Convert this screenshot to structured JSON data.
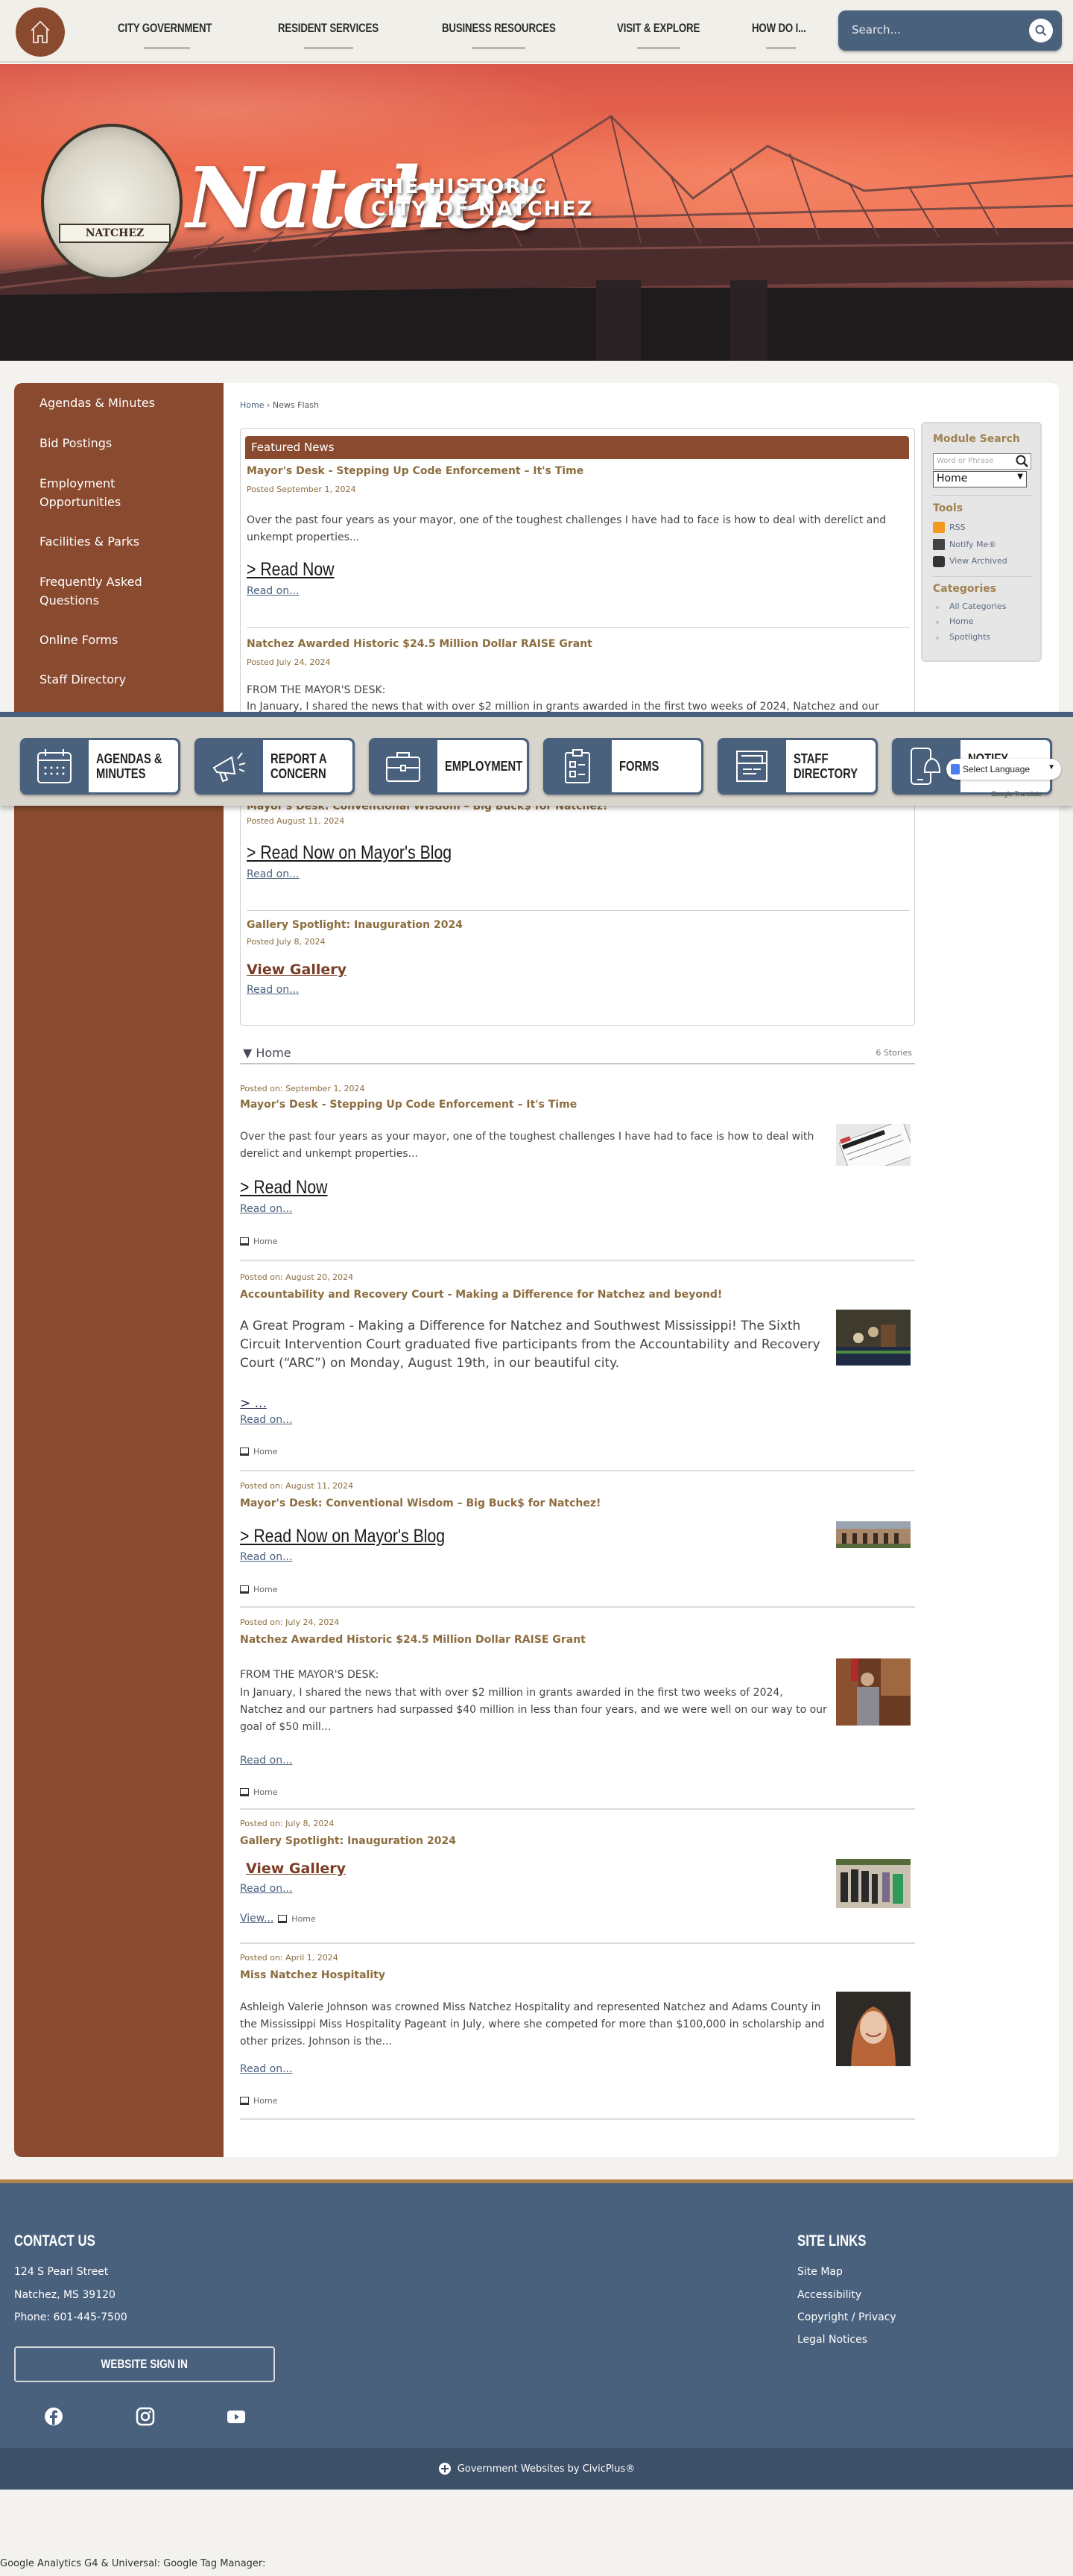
{
  "nav": {
    "items": [
      "CITY GOVERNMENT",
      "RESIDENT SERVICES",
      "BUSINESS RESOURCES",
      "VISIT & EXPLORE",
      "HOW DO I..."
    ],
    "search_placeholder": "Search..."
  },
  "banner": {
    "seal_label": "NATCHEZ",
    "script": "Natchez",
    "sub1": "THE HISTORIC",
    "sub2": "CITY OF NATCHEZ"
  },
  "sidebar": {
    "items": [
      "Agendas & Minutes",
      "Bid Postings",
      "Employment Opportunities",
      "Facilities & Parks",
      "Frequently Asked Questions",
      "Online Forms",
      "Staff Directory"
    ]
  },
  "breadcrumb": {
    "home": "Home",
    "sep": "›",
    "current": "News Flash"
  },
  "featured": {
    "heading": "Featured News",
    "items": [
      {
        "title": "Mayor's Desk - Stepping Up Code Enforcement – It's Time",
        "date": "Posted September 1, 2024",
        "body": "Over the past four years as your mayor, one of the toughest challenges I have had to face is how to deal with derelict and unkempt properties...",
        "link": "> Read Now",
        "readon": "Read on..."
      },
      {
        "title": "Natchez Awarded Historic $24.5 Million Dollar RAISE Grant",
        "date": "Posted July 24, 2024",
        "body1": "FROM THE MAYOR'S DESK:",
        "body2": "In January, I shared the news that with over $2 million in grants awarded in the first two weeks of 2024, Natchez and our"
      },
      {
        "title": "Mayor's Desk: Conventional Wisdom – Big Buck$ for Natchez!",
        "date": "Posted August 11, 2024",
        "link": "> Read Now on Mayor's Blog",
        "readon": "Read on..."
      },
      {
        "title": "Gallery Spotlight: Inauguration 2024",
        "date": "Posted July 8, 2024",
        "link": "View Gallery",
        "readon": "Read on..."
      }
    ]
  },
  "module": {
    "search_heading": "Module Search",
    "search_placeholder": "Word or Phrase",
    "select_value": "Home",
    "tools_heading": "Tools",
    "tools": [
      "RSS",
      "Notify Me®",
      "View Archived"
    ],
    "categories_heading": "Categories",
    "categories": [
      "All Categories",
      "Home",
      "Spotlights"
    ]
  },
  "quicklinks": {
    "tiles": [
      "AGENDAS &\nMINUTES",
      "REPORT A\nCONCERN",
      "EMPLOYMENT",
      "FORMS",
      "STAFF\nDIRECTORY",
      "NOTIFY ME®"
    ],
    "language": "Select Language",
    "translate": "Google Translate"
  },
  "home_list": {
    "title": "Home",
    "count": "6 Stories",
    "stories": [
      {
        "date": "Posted on: September 1, 2024",
        "title": "Mayor's Desk - Stepping Up Code Enforcement – It's Time",
        "body": "Over the past four years as your mayor, one of the toughest challenges I have had to face is how to deal with derelict and unkempt properties...",
        "link": "> Read Now",
        "readon": "Read on...",
        "category": "Home"
      },
      {
        "date": "Posted on: August 20, 2024",
        "title": "Accountability and Recovery Court - Making a Difference for Natchez and beyond!",
        "body": "A Great Program - Making a Difference for Natchez and Southwest Mississippi! The Sixth Circuit Intervention Court graduated five participants from the Accountability and Recovery Court (“ARC”) on Monday, August 19th, in our beautiful city.",
        "link": "> ...",
        "readon": "Read on...",
        "category": "Home"
      },
      {
        "date": "Posted on: August 11, 2024",
        "title": "Mayor's Desk: Conventional Wisdom – Big Buck$ for Natchez!",
        "link": "> Read Now on Mayor's Blog",
        "readon": "Read on...",
        "category": "Home"
      },
      {
        "date": "Posted on: July 24, 2024",
        "title": "Natchez Awarded Historic $24.5 Million Dollar RAISE Grant",
        "body1": "FROM THE MAYOR'S DESK:",
        "body2": "In January, I shared the news that with over $2 million in grants awarded in the first two weeks of 2024, Natchez and our partners had surpassed $40 million in less than four years, and we were well on our way to our goal of $50 mill...",
        "readon": "Read on...",
        "category": "Home"
      },
      {
        "date": "Posted on: July 8, 2024",
        "title": "Gallery Spotlight: Inauguration 2024",
        "link": "View Gallery",
        "readon": "Read on...",
        "view": "View...",
        "category": "Home"
      },
      {
        "date": "Posted on: April 1, 2024",
        "title": "Miss Natchez Hospitality",
        "body": "Ashleigh Valerie Johnson was crowned Miss Natchez Hospitality and represented Natchez and Adams County in the Mississippi Miss Hospitality Pageant in July, where she competed for more than $100,000 in scholarship and other prizes.  Johnson is the...",
        "readon": "Read on...",
        "category": "Home"
      }
    ]
  },
  "footer": {
    "contact_heading": "CONTACT US",
    "address1": "124 S Pearl Street",
    "address2": "Natchez, MS 39120",
    "phone": "Phone: 601-445-7500",
    "signin": "WEBSITE SIGN IN",
    "links_heading": "SITE LINKS",
    "links": [
      "Site Map",
      "Accessibility",
      "Copyright / Privacy",
      "Legal Notices"
    ],
    "social": [
      "facebook",
      "instagram",
      "youtube"
    ],
    "civicplus": "Government Websites by CivicPlus®"
  },
  "analytics_text": "Google Analytics G4 & Universal: Google Tag Manager:",
  "colors": {
    "brand_brown": "#8a4a2f",
    "brand_blue": "#4a617e",
    "accent_gold": "#8c6d3f",
    "footer_rule": "#b0844a"
  }
}
